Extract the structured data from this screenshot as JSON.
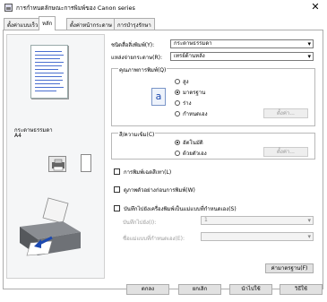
{
  "window": {
    "title": "การกำหนดลักษณะการพิมพ์ของ Canon         series",
    "close_label": "✕"
  },
  "tabs": [
    {
      "label": "ตั้งค่าแบบเร็ว",
      "active": false
    },
    {
      "label": "หลัก",
      "active": true
    },
    {
      "label": "ตั้งค่าหน้ากระดาษ",
      "active": false
    },
    {
      "label": "การบำรุงรักษา",
      "active": false
    }
  ],
  "left_panel": {
    "media": "กระดาษธรรมดา",
    "size": "A4"
  },
  "main": {
    "media_type_label": "ชนิดสื่อสิ่งพิมพ์(Y):",
    "media_type_value": "กระดาษธรรมดา",
    "paper_source_label": "แหล่งจ่ายกระดาษ(R):",
    "paper_source_value": "เทรย์ด้านหลัง",
    "quality_group": "คุณภาพการพิมพ์(Q)",
    "quality_options": [
      {
        "label": "สูง",
        "selected": false
      },
      {
        "label": "มาตรฐาน",
        "selected": true
      },
      {
        "label": "ร่าง",
        "selected": false
      },
      {
        "label": "กำหนดเอง",
        "selected": false
      }
    ],
    "quality_set_button": "ตั้งค่า...",
    "color_group": "สี/ความเข้ม(C)",
    "color_options": [
      {
        "label": "อัตโนมัติ",
        "selected": true
      },
      {
        "label": "ด้วยตัวเอง",
        "selected": false
      }
    ],
    "color_set_button": "ตั้งค่า...",
    "grayscale_label": "การพิมพ์เฉดสีเทา(L)",
    "preview_label": "ดูภาพตัวอย่างก่อนการพิมพ์(W)",
    "save_custom_label": "บันทึกไปยังเครื่องพิมพ์เป็นแม่แบบที่กำหนดเอง(S)",
    "save_to_label": "บันทึกไปยัง(I):",
    "save_to_value": "1",
    "template_name_label": "ชื่อแม่แบบที่กำหนดเอง(E):",
    "defaults_button": "ค่ามาตรฐาน(F)"
  },
  "footer": {
    "ok": "ตกลง",
    "cancel": "ยกเลิก",
    "apply": "นำไปใช้",
    "help": "วิธีใช้"
  },
  "colors": {
    "tab_border": "#adadad",
    "panel_bg": "#f5f6f7",
    "accent": "#1c49b0"
  },
  "icons": [
    "printer-app-icon",
    "close-icon",
    "quality-a-icon",
    "printer-button-icon",
    "paper-button-icon",
    "printer-illustration"
  ]
}
